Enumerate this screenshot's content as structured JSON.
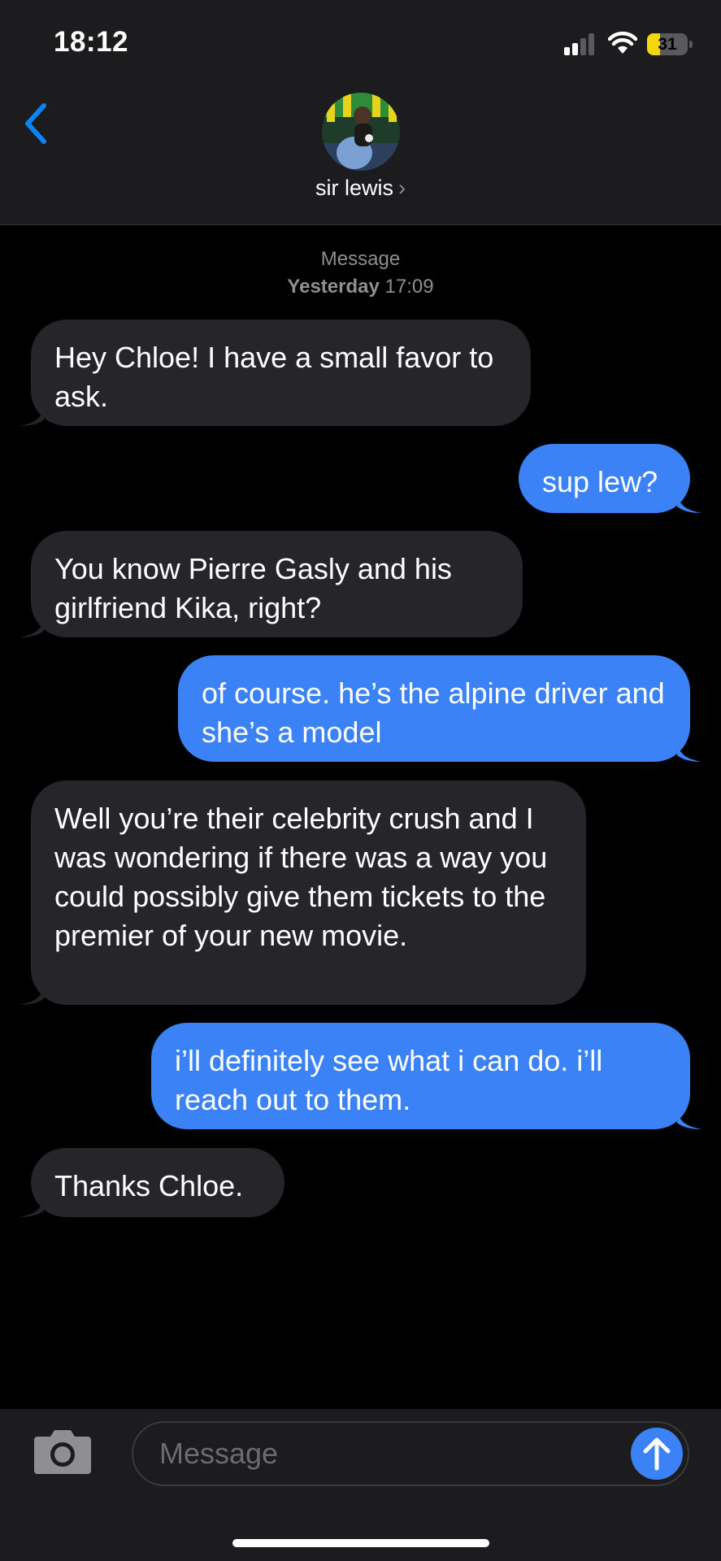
{
  "status": {
    "time": "18:12",
    "battery": "31",
    "battery_level": 0.31
  },
  "header": {
    "contact_name": "sir lewis",
    "chevron": "›"
  },
  "thread": {
    "service": "Message",
    "day": "Yesterday",
    "time": "17:09"
  },
  "messages": [
    {
      "side": "received",
      "text": "Hey Chloe! I have a small favor to ask."
    },
    {
      "side": "sent",
      "text": "sup lew?"
    },
    {
      "side": "received",
      "text": "You know Pierre Gasly and his girlfriend Kika, right?"
    },
    {
      "side": "sent",
      "text": "of course. he’s the alpine driver and she’s a model"
    },
    {
      "side": "received",
      "text": "Well you’re their celebrity crush and I was wondering if there was a way you could possibly give them tickets to the premier of your new movie."
    },
    {
      "side": "sent",
      "text": "i’ll definitely see what i can do. i’ll reach out to them."
    },
    {
      "side": "received",
      "text": "Thanks Chloe."
    }
  ],
  "composer": {
    "placeholder": "Message"
  },
  "colors": {
    "sent": "#3b82f6",
    "received": "#26252a",
    "accent": "#0a84ff"
  },
  "icons": [
    "back-chevron-icon",
    "camera-icon",
    "send-arrow-icon",
    "signal-icon",
    "wifi-icon",
    "battery-icon"
  ]
}
